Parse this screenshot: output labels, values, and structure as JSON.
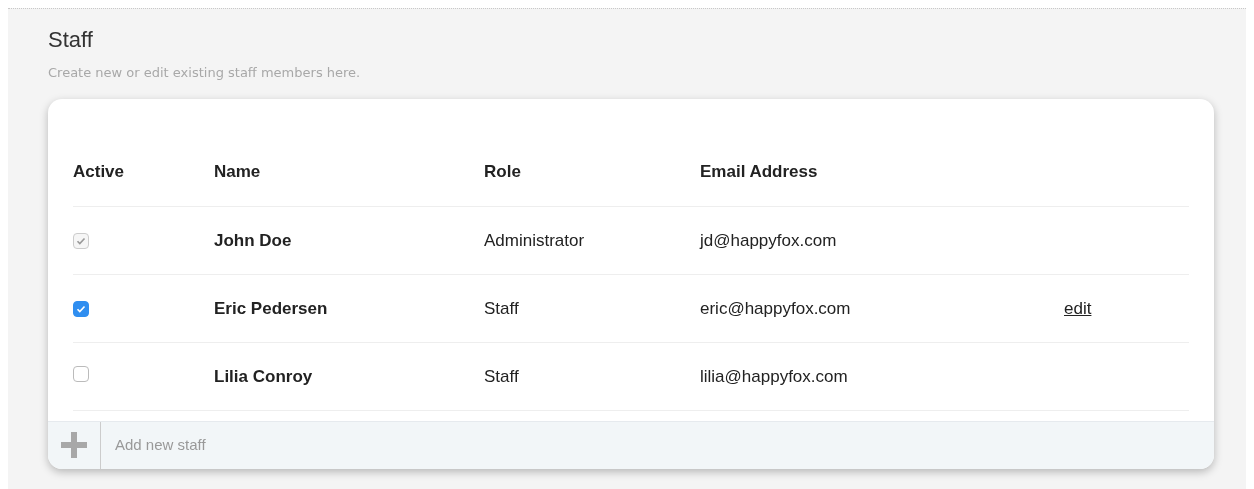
{
  "header": {
    "title": "Staff",
    "subtitle": "Create new or edit existing staff members here."
  },
  "table": {
    "columns": [
      "Active",
      "Name",
      "Role",
      "Email Address"
    ],
    "rows": [
      {
        "checked": true,
        "disabled": true,
        "name": "John Doe",
        "role": "Administrator",
        "email": "jd@happyfox.com"
      },
      {
        "checked": true,
        "disabled": false,
        "name": "Eric Pedersen",
        "role": "Staff",
        "email": "eric@happyfox.com",
        "action": "edit"
      },
      {
        "checked": false,
        "disabled": false,
        "name": "Lilia Conroy",
        "role": "Staff",
        "email": "lilia@happyfox.com"
      }
    ]
  },
  "footer": {
    "placeholder": "Add new staff"
  }
}
